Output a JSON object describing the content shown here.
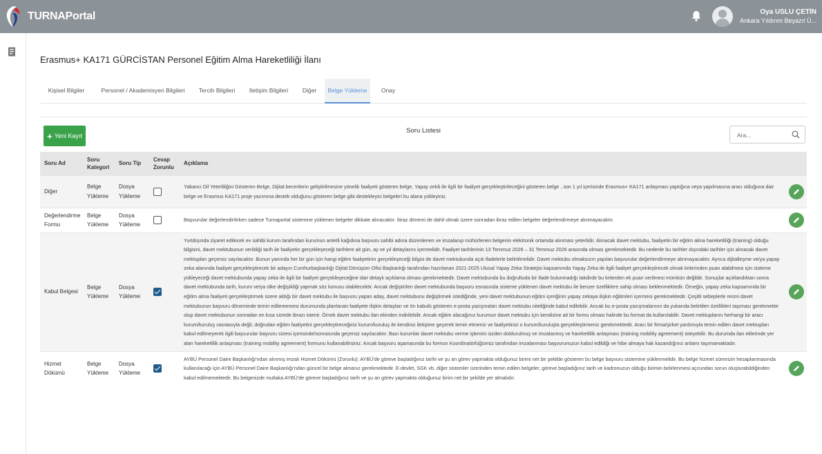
{
  "app": {
    "brand": "TURNAPortal"
  },
  "user": {
    "name": "Oya USLU ÇETİN",
    "role": "Ankara Yıldırım Beyazıt Ü..."
  },
  "page": {
    "title": "Erasmus+ KA171 GÜRCİSTAN Personel Eğitim Alma Hareketliliği İlanı"
  },
  "tabs": [
    {
      "label": "Kişisel Bilgiler",
      "active": false
    },
    {
      "label": "Personel / Akademisyen Bilgileri",
      "active": false
    },
    {
      "label": "Tercih Bilgileri",
      "active": false
    },
    {
      "label": "İletişim Bilgileri",
      "active": false
    },
    {
      "label": "Diğer",
      "active": false
    },
    {
      "label": "Belge Yükleme",
      "active": true
    },
    {
      "label": "Onay",
      "active": false
    }
  ],
  "toolbar": {
    "new_label": "Yeni Kayıt",
    "list_title": "Soru Listesi",
    "search_placeholder": "Ara..."
  },
  "table": {
    "headers": [
      "Soru Ad",
      "Soru Kategori",
      "Soru Tip",
      "Cevap Zorunlu",
      "Açıklama",
      ""
    ],
    "rows": [
      {
        "ad": "Diğer",
        "kategori": "Belge Yükleme",
        "tip": "Dosya Yükleme",
        "zorunlu": false,
        "aciklama": "Yabancı Dil Yeterliliğini Gösteren Belge, Dijital becerilerin geliştirilmesine yönelik faaliyeti gösteren belge, Yapay zekâ ile ilgili bir faaliyet gerçekleştirileceğini gösteren belge , son 1 yıl içerisinde Erasmus+ KA171 anlaşması yaptığına veya yapılmasına aracı olduğuna dair belge ve Erasmus KA171 proje yazımına destek olduğunu gösteren belge gibi destekleyici belgeleri bu alana yükleyiniz."
      },
      {
        "ad": "Değerlendirme Formu",
        "kategori": "Belge Yükleme",
        "tip": "Dosya Yükleme",
        "zorunlu": false,
        "aciklama": "Başvurular değerlendirilirken sadece Turnaportal sistemine yüklenen belgeler dikkate alınacaktır. İtiraz dönemi de dahil olmak üzere sonradan ibraz edilen belgeler değerlendirmeye alınmayacaktır."
      },
      {
        "ad": "Kabul Belgesi",
        "kategori": "Belge Yükleme",
        "tip": "Dosya Yükleme",
        "zorunlu": true,
        "aciklama": "Yurtdışında ziyaret edilecek ev sahibi kurum tarafından kurumun antetli kağıdına başvuru sahibi adına düzenlenen ve imzalanıp mühürlenen belgenin elektronik ortamda alınması yeterlidir. Alınacak davet mektubu, faaliyetin bir eğitim alma hareketliliği (training) olduğu bilgisini, davet mektubunun verildiği tarih ile faaliyetin gerçekleşeceği tarihlere ait gün, ay ve yıl detaylarını içermelidir. Faaliyet tarihlerinin 13 Temmuz 2026 – 31 Temmuz 2026 arasında olması gerekmektedir. Bu nedenle bu tarihler dışındaki tarihler için alınacak davet mektupları geçersiz sayılacaktır. Bunun yanında her bir gün için hangi eğitim faaliyetinin gerçekleşeceği bilgisi de davet mektubunda açık ifadelerle belirtilmelidir. Davet mektubu olmaksızın yapılan başvurular değerlendirmeye alınmayacaktır. Ayrıca dijitalleşme ve/ya yapay zeka alanında faaliyet gerçekleştirecek bir adayın Cumhurbaşkanlığı Dijital Dönüşüm Ofisi Başkanlığı tarafından hazırlanan 2021-2025 Ulusal Yapay Zeka Stratejisi kapsamında Yapay Zeka ile ilgili faaliyet gerçekleştirecek olmak kriterinden puan alabilmesi için sisteme yükleyeceği davet mektubunda yapay zeka ile ilgili bir faaliyet gerçekleşeceğine dair detaylı açıklama olması gerekmektedir. Davet mektubunda bu doğrultuda bir ifade bulunmadığı takdirde bu kriterden ek puan verilmesi mümkün değildir. Sonuçlar açıklandıktan sonra davet mektubunda tarih, kurum ve/ya ülke değişikliği yapmak söz konusu olabilecektir. Ancak değiştirilen davet mektubunda başvuru esnasında sisteme yüklenen davet mektubu ile benzer özelliklere sahip olması beklenmektedir. Örneğin, yapay zeka kapsamında bir eğitim alma faaliyeti gerçekleştirmek üzere aldığı bir davet mektubu ile başvuru yapan aday, davet mektubunu değiştirmek istediğinde, yeni davet mektubunun eğitim içeriğinin yapay zekaya ilişkin eğitimleri içermesi gerekmektedir. Çeşitli sebeplerle resmi davet mektubunun başvuru döneminde temin edilememesi durumunda planlanan faaliyete ilişkin detayları ve ön kabulü gösteren e-posta yazışmaları davet mektubu niteliğinde kabul edilebilir. Ancak bu e-posta yazışmalarının da yukarıda belirtilen özellikleri taşıması gerekmekte olup davet mektubunun sonradan en kısa sürede ibrazı istenir. Örnek davet mektubu ilan ekinden indirilebilir. Ancak eğitim alacağınız kurumun davet mektubu için kendisine ait bir formu olması halinde bu format da kullanılabilir. Davet mektuplarını herhangi bir aracı kurum/kuruluş vasıtasıyla değil, doğrudan eğitim faaliyetini gerçekleştireceğiniz kurum/kuruluş ile kendiniz iletişime geçerek temin etmeniz ve faaliyetinizi o kurum/kuruluşta gerçekleştirmeniz gerekmektedir. Aracı bir firma/şirket yardımıyla temin edilen davet mektupları kabul edilmeyerek ilgili başvurular başvuru süresi içerisinde/sonrasında geçersiz sayılacaktır. Bazı kurumlar davet mektubu verme işlemini sizden doldurulmuş ve imzalanmış ve hareketlilik anlaşması (training mobility agreement) isteyebilir. Bu durumda ilan eklerinde yer alan hareketlilik anlaşması (training mobility agreement) formunu kullanabilirsiniz. Ancak başvuru aşamasında bu formun Koordinatörlüğümüz tarafından imzalanması başvurunuzun kabul edildiği ve hibe almaya hak kazandığınız anlamı taşımamaktadır."
      },
      {
        "ad": "Hizmet Dökümü",
        "kategori": "Belge Yükleme",
        "tip": "Dosya Yükleme",
        "zorunlu": true,
        "aciklama": "AYBÜ Personel Daire Başkanlığı'ndan alınmış imzalı Hizmet Dökümü (Zorunlu): AYBÜ'de göreve başladığınız tarihi ve şu an görev yapmakta olduğunuz birimi net bir şekilde gösteren bu belge başvuru sistemine yüklenmelidir. Bu belge hizmet sürenizin hesaplanmasında kullanılacağı için AYBÜ Personel Daire Başkanlığı'ndan güncel bir belge almanız gerekmektedir. E-devlet, SGK vb. diğer sistemler üzerinden temin edilen belgeler, göreve başladığınız tarih ve kadronuzun olduğu birimin belirlenmesi açısından sorun oluşturabildiğinden kabul edilmemektedir. Bu belgenizde mutlaka AYBÜ'de göreve başladığınız tarih ve şu an görev yapmakta olduğunuz birim net bir şekilde yer almalıdır."
      }
    ]
  },
  "colors": {
    "topbar": "#8b9298",
    "accent": "#5b8fd3",
    "new_button": "#3aa349",
    "edit_button": "#57a55a",
    "checkbox": "#1e5b8c"
  },
  "icons": {
    "logo": "turna-bird-logo",
    "notifications": "bell-icon",
    "sidebar": "document-icon",
    "search": "search-icon",
    "edit": "pencil-icon"
  }
}
